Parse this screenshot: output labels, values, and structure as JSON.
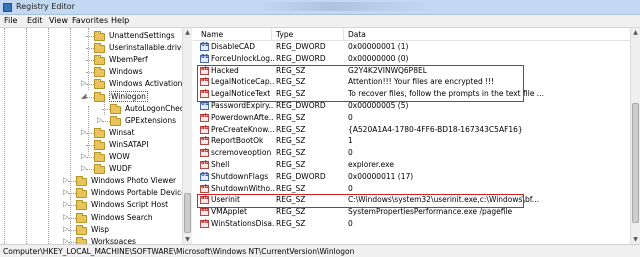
{
  "window": {
    "title": "Registry Editor"
  },
  "menu": [
    "File",
    "Edit",
    "View",
    "Favorites",
    "Help"
  ],
  "tree": {
    "items": [
      {
        "label": "UnattendSettings",
        "indent": 1,
        "expander": false
      },
      {
        "label": "Userinstallable.drivers",
        "indent": 1,
        "expander": false
      },
      {
        "label": "WbemPerf",
        "indent": 1,
        "expander": false
      },
      {
        "label": "Windows",
        "indent": 1,
        "expander": false
      },
      {
        "label": "Windows Activation Tec",
        "indent": 1,
        "expander": true
      },
      {
        "label": "Winlogon",
        "indent": 1,
        "expander": true,
        "expanded": true,
        "selected": true
      },
      {
        "label": "AutoLogonChecked",
        "indent": 2,
        "expander": false
      },
      {
        "label": "GPExtensions",
        "indent": 2,
        "expander": true
      },
      {
        "label": "Winsat",
        "indent": 1,
        "expander": true
      },
      {
        "label": "WinSATAPI",
        "indent": 1,
        "expander": false
      },
      {
        "label": "WOW",
        "indent": 1,
        "expander": true
      },
      {
        "label": "WUDF",
        "indent": 1,
        "expander": true
      },
      {
        "label": "Windows Photo Viewer",
        "indent": 0,
        "expander": true
      },
      {
        "label": "Windows Portable Devices",
        "indent": 0,
        "expander": true
      },
      {
        "label": "Windows Script Host",
        "indent": 0,
        "expander": true
      },
      {
        "label": "Windows Search",
        "indent": 0,
        "expander": true
      },
      {
        "label": "Wisp",
        "indent": 0,
        "expander": true
      },
      {
        "label": "Workspaces",
        "indent": 0,
        "expander": true
      }
    ]
  },
  "list": {
    "columns": {
      "name": "Name",
      "type": "Type",
      "data": "Data"
    },
    "rows": [
      {
        "name": "DisableCAD",
        "type": "REG_DWORD",
        "data": "0x00000001 (1)",
        "kind": "dw"
      },
      {
        "name": "ForceUnlockLog...",
        "type": "REG_DWORD",
        "data": "0x00000000 (0)",
        "kind": "dw"
      },
      {
        "name": "Hacked",
        "type": "REG_SZ",
        "data": "G2Y4K2VINWQ6P8EL",
        "kind": "sz"
      },
      {
        "name": "LegalNoticeCap...",
        "type": "REG_SZ",
        "data": "Attention!!! Your files are encrypted !!!",
        "kind": "sz"
      },
      {
        "name": "LegalNoticeText",
        "type": "REG_SZ",
        "data": "To recover files, follow the prompts in the text file ...",
        "kind": "sz"
      },
      {
        "name": "PasswordExpiry...",
        "type": "REG_DWORD",
        "data": "0x00000005 (5)",
        "kind": "dw"
      },
      {
        "name": "PowerdownAfte...",
        "type": "REG_SZ",
        "data": "0",
        "kind": "sz"
      },
      {
        "name": "PreCreateKnow...",
        "type": "REG_SZ",
        "data": "{A520A1A4-1780-4FF6-BD18-167343C5AF16}",
        "kind": "sz"
      },
      {
        "name": "ReportBootOk",
        "type": "REG_SZ",
        "data": "1",
        "kind": "sz"
      },
      {
        "name": "scremoveoption",
        "type": "REG_SZ",
        "data": "0",
        "kind": "sz"
      },
      {
        "name": "Shell",
        "type": "REG_SZ",
        "data": "explorer.exe",
        "kind": "sz"
      },
      {
        "name": "ShutdownFlags",
        "type": "REG_DWORD",
        "data": "0x00000011 (17)",
        "kind": "dw"
      },
      {
        "name": "ShutdownWitho...",
        "type": "REG_SZ",
        "data": "0",
        "kind": "sz"
      },
      {
        "name": "Userinit",
        "type": "REG_SZ",
        "data": "C:\\Windows\\system32\\userinit.exe,c:\\Windows\\bf...",
        "kind": "sz"
      },
      {
        "name": "VMApplet",
        "type": "REG_SZ",
        "data": "SystemPropertiesPerformance.exe /pagefile",
        "kind": "sz"
      },
      {
        "name": "WinStationsDisa...",
        "type": "REG_SZ",
        "data": "0",
        "kind": "sz"
      }
    ]
  },
  "status": {
    "path": "Computer\\HKEY_LOCAL_MACHINE\\SOFTWARE\\Microsoft\\Windows NT\\CurrentVersion\\Winlogon"
  },
  "colors": {
    "highlight_box": "#d32020",
    "titlebar": "#c3d9f1"
  }
}
